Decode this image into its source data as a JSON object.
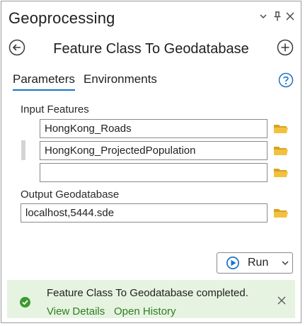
{
  "pane": {
    "title": "Geoprocessing",
    "controls": {
      "menu_icon": "chevron-down-icon",
      "pin_icon": "pin-icon",
      "close_icon": "close-icon"
    }
  },
  "tool": {
    "title": "Feature Class To Geodatabase",
    "back_icon": "back-arrow-icon",
    "add_icon": "add-circle-icon"
  },
  "tabs": [
    {
      "label": "Parameters",
      "active": true
    },
    {
      "label": "Environments",
      "active": false
    }
  ],
  "help_icon": "help-icon",
  "parameters": {
    "input_features": {
      "label": "Input Features",
      "items": [
        {
          "value": "HongKong_Roads"
        },
        {
          "value": "HongKong_ProjectedPopulation"
        },
        {
          "value": ""
        }
      ]
    },
    "output_geodatabase": {
      "label": "Output Geodatabase",
      "value": "localhost,5444.sde"
    }
  },
  "run": {
    "label": "Run",
    "icon": "play-icon",
    "menu_icon": "chevron-down-icon"
  },
  "message": {
    "status": "success",
    "text": "Feature Class To Geodatabase completed.",
    "links": [
      "View Details",
      "Open History"
    ]
  },
  "colors": {
    "accent": "#1a73c7",
    "folder": "#e8b531",
    "success_bg": "#e6f3e1",
    "success_icon": "#3c9a2f",
    "link": "#2f7d23"
  }
}
